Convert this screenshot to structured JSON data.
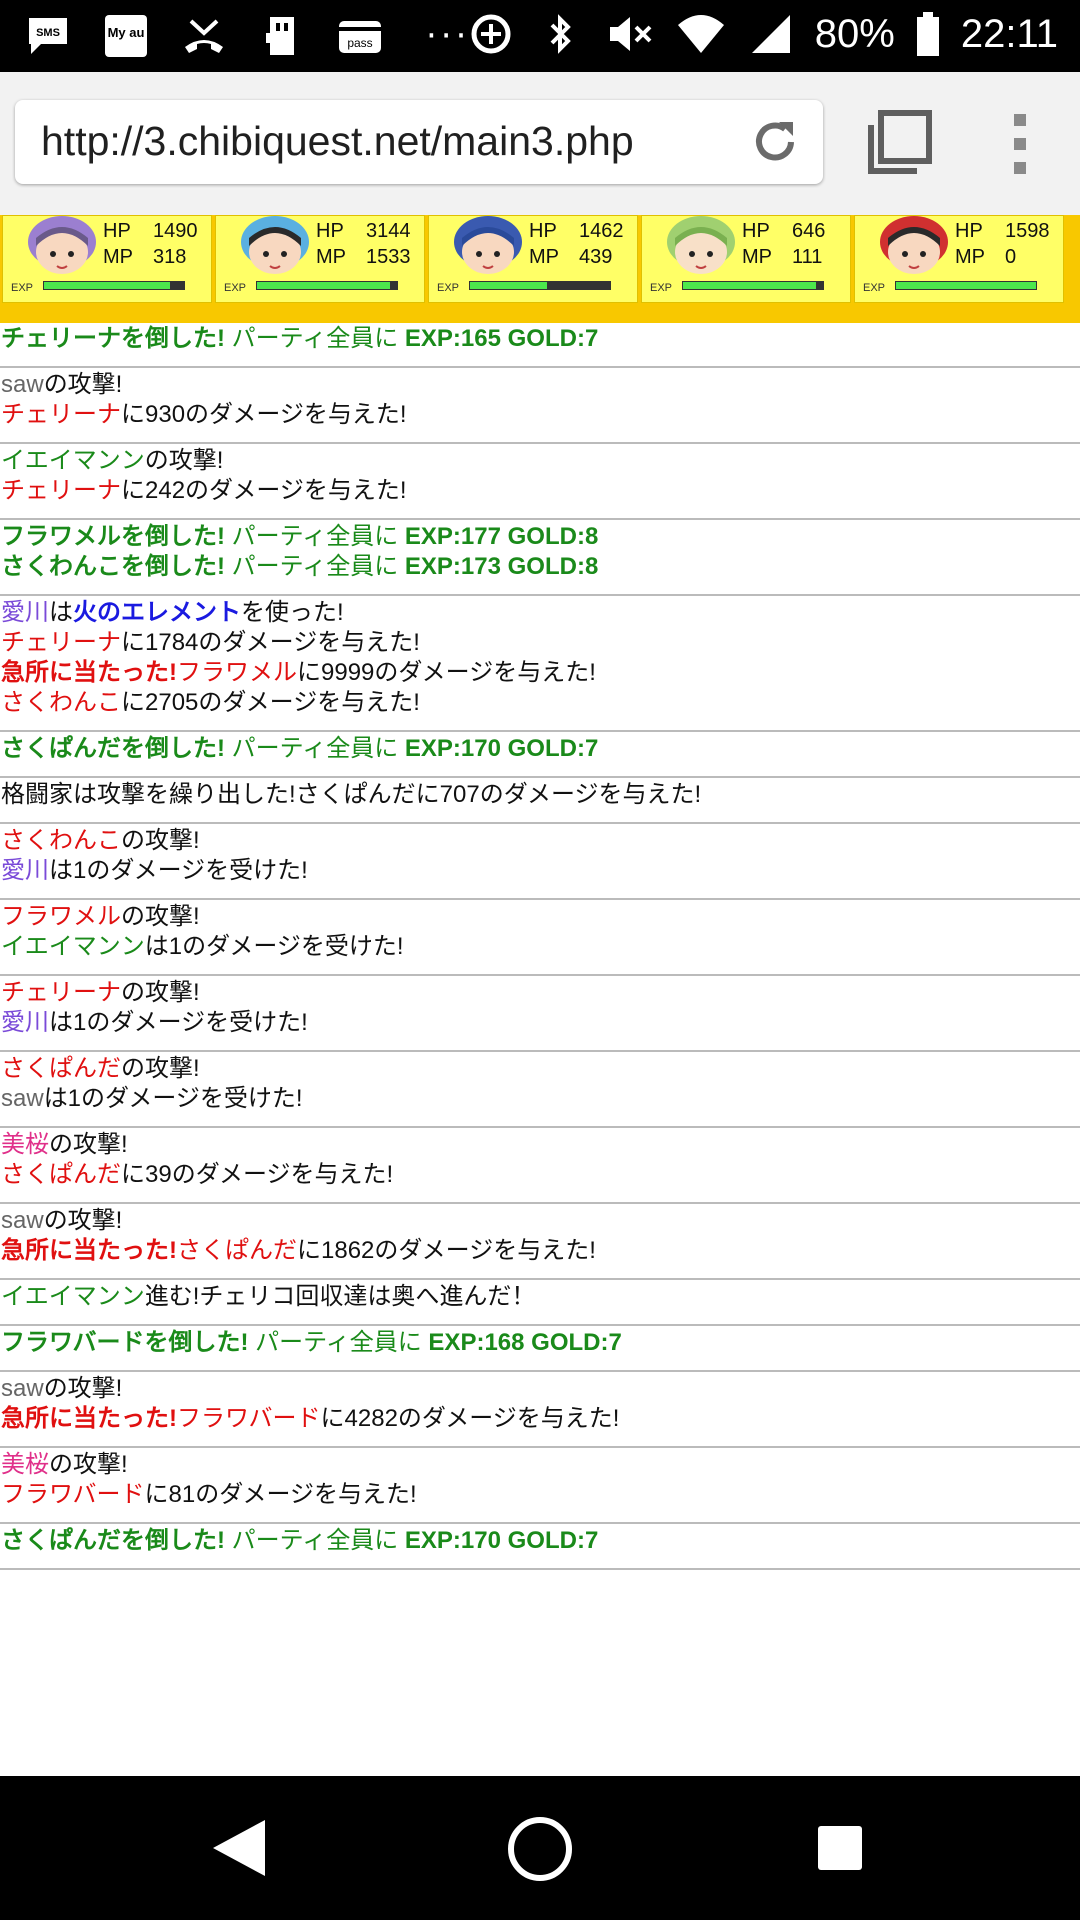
{
  "status": {
    "battery": "80%",
    "time": "22:11",
    "sms": "SMS",
    "myau": "My au",
    "pass": "pass"
  },
  "url": {
    "text": "http://3.chibiquest.net/main3.php"
  },
  "party": [
    {
      "hp_label": "HP",
      "hp": "1490",
      "mp_label": "MP",
      "mp": "318",
      "exp_label": "EXP",
      "exp": 0.9
    },
    {
      "hp_label": "HP",
      "hp": "3144",
      "mp_label": "MP",
      "mp": "1533",
      "exp_label": "EXP",
      "exp": 0.95
    },
    {
      "hp_label": "HP",
      "hp": "1462",
      "mp_label": "MP",
      "mp": "439",
      "exp_label": "EXP",
      "exp": 0.55
    },
    {
      "hp_label": "HP",
      "hp": "646",
      "mp_label": "MP",
      "mp": "111",
      "exp_label": "EXP",
      "exp": 0.95
    },
    {
      "hp_label": "HP",
      "hp": "1598",
      "mp_label": "MP",
      "mp": "0",
      "exp_label": "EXP",
      "exp": 1.0
    }
  ],
  "log": [
    [
      [
        [
          "gb",
          "チェリーナを倒した!"
        ],
        [
          "g",
          " パーティ全員に "
        ],
        [
          "gb",
          "EXP:165 GOLD:7"
        ]
      ]
    ],
    [
      [
        [
          "gr",
          "saw"
        ],
        [
          "",
          "の攻撃!"
        ]
      ],
      [
        [
          "r",
          "チェリーナ"
        ],
        [
          "",
          "に930のダメージを与えた!"
        ]
      ]
    ],
    [
      [
        [
          "g",
          "イエイマンン"
        ],
        [
          "",
          "の攻撃!"
        ]
      ],
      [
        [
          "r",
          "チェリーナ"
        ],
        [
          "",
          "に242のダメージを与えた!"
        ]
      ]
    ],
    [
      [
        [
          "gb",
          "フラワメルを倒した!"
        ],
        [
          "g",
          " パーティ全員に "
        ],
        [
          "gb",
          "EXP:177 GOLD:8"
        ]
      ],
      [
        [
          "gb",
          "さくわんこを倒した!"
        ],
        [
          "g",
          " パーティ全員に "
        ],
        [
          "gb",
          "EXP:173 GOLD:8"
        ]
      ]
    ],
    [
      [
        [
          "p",
          "愛川"
        ],
        [
          "",
          "は"
        ],
        [
          "bl",
          "火のエレメント"
        ],
        [
          "",
          "を使った!"
        ]
      ],
      [
        [
          "r",
          "チェリーナ"
        ],
        [
          "",
          "に1784のダメージを与えた!"
        ]
      ],
      [
        [
          "rb",
          "急所に当たった!"
        ],
        [
          "r",
          "フラワメル"
        ],
        [
          "",
          "に9999のダメージを与えた!"
        ]
      ],
      [
        [
          "r",
          "さくわんこ"
        ],
        [
          "",
          "に2705のダメージを与えた!"
        ]
      ]
    ],
    [
      [
        [
          "gb",
          "さくぱんだを倒した!"
        ],
        [
          "g",
          " パーティ全員に "
        ],
        [
          "gb",
          "EXP:170 GOLD:7"
        ]
      ]
    ],
    [
      [
        [
          "",
          "格闘家は攻撃を繰り出した!さくぱんだに707のダメージを与えた!"
        ]
      ]
    ],
    [
      [
        [
          "r",
          "さくわんこ"
        ],
        [
          "",
          "の攻撃!"
        ]
      ],
      [
        [
          "p",
          "愛川"
        ],
        [
          "",
          "は1のダメージを受けた!"
        ]
      ]
    ],
    [
      [
        [
          "r",
          "フラワメル"
        ],
        [
          "",
          "の攻撃!"
        ]
      ],
      [
        [
          "g",
          "イエイマンン"
        ],
        [
          "",
          "は1のダメージを受けた!"
        ]
      ]
    ],
    [
      [
        [
          "r",
          "チェリーナ"
        ],
        [
          "",
          "の攻撃!"
        ]
      ],
      [
        [
          "p",
          "愛川"
        ],
        [
          "",
          "は1のダメージを受けた!"
        ]
      ]
    ],
    [
      [
        [
          "r",
          "さくぱんだ"
        ],
        [
          "",
          "の攻撃!"
        ]
      ],
      [
        [
          "gr",
          "saw"
        ],
        [
          "",
          "は1のダメージを受けた!"
        ]
      ]
    ],
    [
      [
        [
          "pk",
          "美桜"
        ],
        [
          "",
          "の攻撃!"
        ]
      ],
      [
        [
          "r",
          "さくぱんだ"
        ],
        [
          "",
          "に39のダメージを与えた!"
        ]
      ]
    ],
    [
      [
        [
          "gr",
          "saw"
        ],
        [
          "",
          "の攻撃!"
        ]
      ],
      [
        [
          "rb",
          "急所に当たった!"
        ],
        [
          "r",
          "さくぱんだ"
        ],
        [
          "",
          "に1862のダメージを与えた!"
        ]
      ]
    ],
    [
      [
        [
          "g",
          "イエイマンン"
        ],
        [
          "",
          "進む!チェリコ回収達は奥へ進んだ！"
        ]
      ]
    ],
    [
      [
        [
          "gb",
          "フラワバードを倒した!"
        ],
        [
          "g",
          " パーティ全員に "
        ],
        [
          "gb",
          "EXP:168 GOLD:7"
        ]
      ]
    ],
    [
      [
        [
          "gr",
          "saw"
        ],
        [
          "",
          "の攻撃!"
        ]
      ],
      [
        [
          "rb",
          "急所に当たった!"
        ],
        [
          "r",
          "フラワバード"
        ],
        [
          "",
          "に4282のダメージを与えた!"
        ]
      ]
    ],
    [
      [
        [
          "pk",
          "美桜"
        ],
        [
          "",
          "の攻撃!"
        ]
      ],
      [
        [
          "r",
          "フラワバード"
        ],
        [
          "",
          "に81のダメージを与えた!"
        ]
      ]
    ],
    [
      [
        [
          "gb",
          "さくぱんだを倒した!"
        ],
        [
          "g",
          " パーティ全員に "
        ],
        [
          "gb",
          "EXP:170 GOLD:7"
        ]
      ]
    ]
  ]
}
